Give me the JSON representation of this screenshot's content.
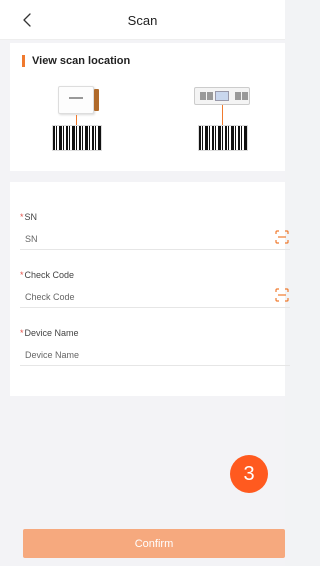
{
  "header": {
    "title": "Scan"
  },
  "scan_section": {
    "title": "View scan location"
  },
  "form": {
    "sn": {
      "label": "SN",
      "placeholder": "SN"
    },
    "check_code": {
      "label": "Check Code",
      "placeholder": "Check Code"
    },
    "device_name": {
      "label": "Device Name",
      "placeholder": "Device Name"
    },
    "required_mark": "*"
  },
  "badge": {
    "number": "3"
  },
  "footer": {
    "confirm_label": "Confirm"
  },
  "colors": {
    "accent": "#f07a2e",
    "confirm_bg": "#f6a97e",
    "badge_bg": "#ff5a1f",
    "required": "#e5534b"
  },
  "icons": {
    "back": "chevron-left-icon",
    "scan": "scan-frame-icon"
  }
}
